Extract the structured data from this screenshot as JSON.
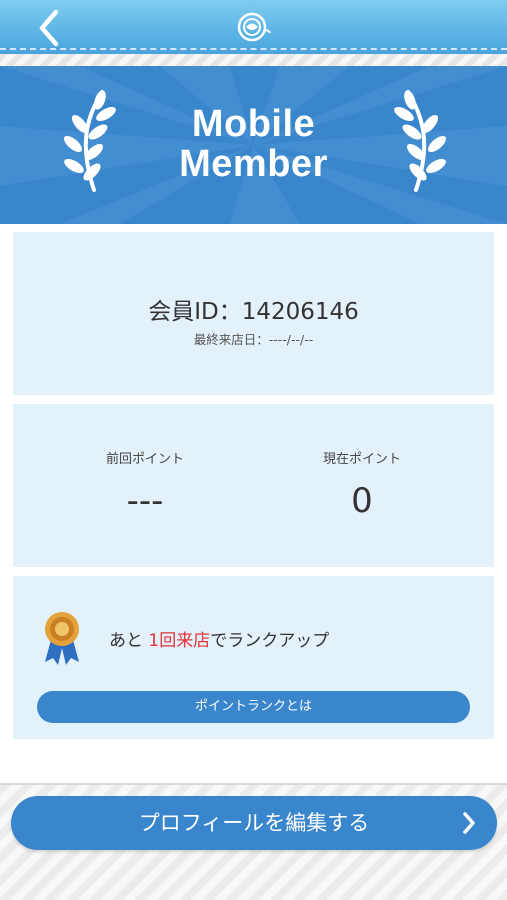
{
  "header": {
    "back_icon": "chevron-left-icon",
    "logo_icon": "app-logo-icon"
  },
  "banner": {
    "title_line1": "Mobile",
    "title_line2": "Member"
  },
  "member": {
    "id_label": "会員ID：14206146",
    "last_visit": "最終来店日：----/--/--"
  },
  "points": {
    "previous_label": "前回ポイント",
    "previous_value": "---",
    "current_label": "現在ポイント",
    "current_value": "0"
  },
  "rank": {
    "text_prefix": "あと ",
    "text_highlight": "1回来店",
    "text_suffix": "でランクアップ",
    "button_label": "ポイントランクとは",
    "highlight_color": "#e1343a"
  },
  "footer": {
    "profile_button_label": "プロフィールを編集する"
  },
  "colors": {
    "accent": "#3a86cc",
    "card_bg": "#e3f1fb"
  }
}
